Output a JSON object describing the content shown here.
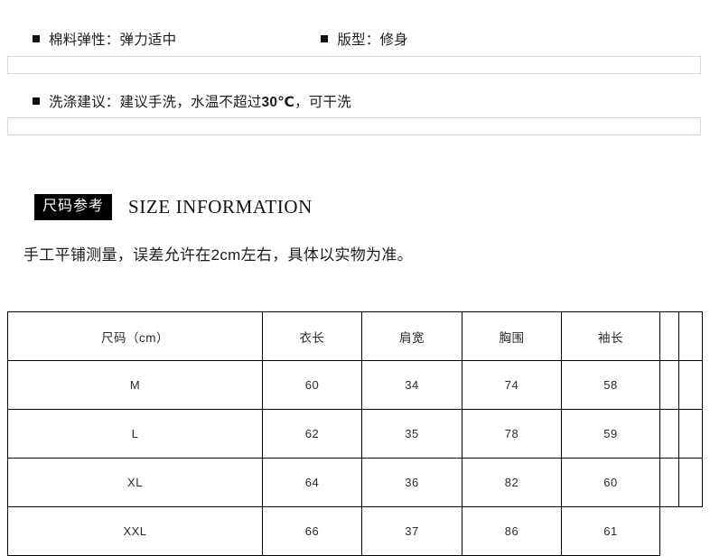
{
  "attributes": {
    "row1": [
      {
        "label": "棉料弹性：",
        "value": "弹力适中"
      },
      {
        "label": "版型：",
        "value": "修身"
      }
    ],
    "row2": [
      {
        "label": "洗涤建议：",
        "value_pre": "建议手洗，水温不超过",
        "value_strong": "30℃",
        "value_post": "，可干洗"
      }
    ]
  },
  "size_section": {
    "badge": "尺码参考",
    "title_en": "SIZE INFORMATION",
    "note": "手工平铺测量，误差允许在2cm左右，具体以实物为准。"
  },
  "size_table": {
    "headers": [
      "尺码（cm）",
      "衣长",
      "肩宽",
      "胸围",
      "袖长",
      "",
      ""
    ],
    "rows": [
      [
        "M",
        "60",
        "34",
        "74",
        "58",
        "",
        ""
      ],
      [
        "L",
        "62",
        "35",
        "78",
        "59",
        "",
        ""
      ],
      [
        "XL",
        "64",
        "36",
        "82",
        "60",
        "",
        ""
      ],
      [
        "XXL",
        "66",
        "37",
        "86",
        "61",
        "",
        ""
      ]
    ]
  },
  "colors": {
    "badge_bg": "#000000",
    "badge_text": "#ffffff",
    "table_border": "#000000",
    "bar_border": "#d9d9d9",
    "text": "#1c1c1c"
  }
}
